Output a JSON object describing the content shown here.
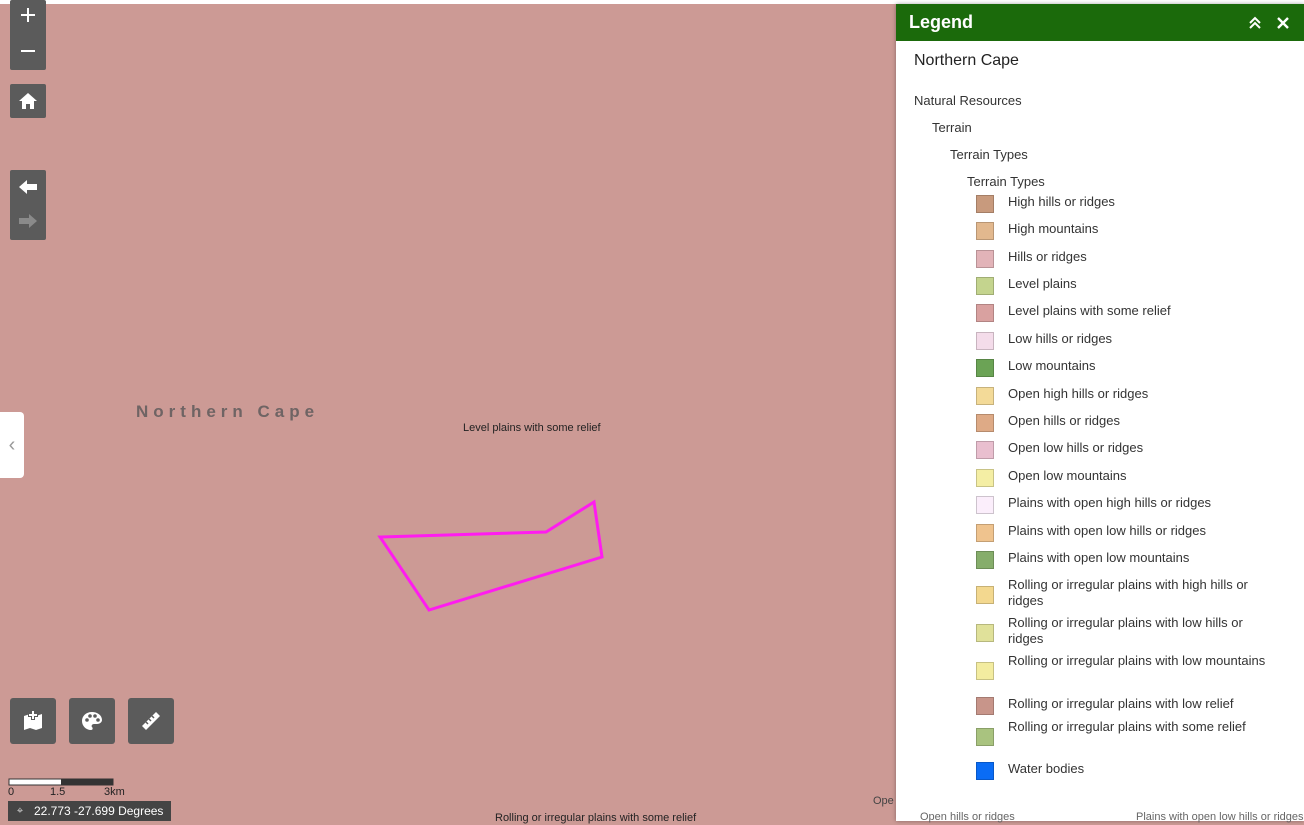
{
  "map": {
    "region_label": "Northern Cape",
    "center_label": "Level plains with some relief",
    "bottom_label": "Rolling or irregular plains with some relief",
    "edge_label": "Ope"
  },
  "scalebar": {
    "ticks": [
      "0",
      "1.5",
      "3km"
    ]
  },
  "coords": {
    "text": "22.773 -27.699 Degrees"
  },
  "legend": {
    "title": "Legend",
    "layer_title": "Northern Cape",
    "tree": [
      "Natural Resources",
      "Terrain",
      "Terrain Types",
      "Terrain Types"
    ],
    "items": [
      {
        "label": "High hills or ridges",
        "color": "#c89a7d"
      },
      {
        "label": "High mountains",
        "color": "#e2b88e"
      },
      {
        "label": "Hills or ridges",
        "color": "#e2b3b8"
      },
      {
        "label": "Level plains",
        "color": "#c4d48e"
      },
      {
        "label": "Level plains with some relief",
        "color": "#d9a1a0"
      },
      {
        "label": "Low hills or ridges",
        "color": "#f4dcea"
      },
      {
        "label": "Low mountains",
        "color": "#6ba355"
      },
      {
        "label": "Open high hills or ridges",
        "color": "#f3da98"
      },
      {
        "label": "Open hills or ridges",
        "color": "#deaa86"
      },
      {
        "label": "Open low hills or ridges",
        "color": "#e9bfcf"
      },
      {
        "label": "Open low mountains",
        "color": "#f4eea4"
      },
      {
        "label": "Plains with open high hills or ridges",
        "color": "#fbeefb"
      },
      {
        "label": "Plains with open low hills or ridges",
        "color": "#efc38e"
      },
      {
        "label": "Plains with open low mountains",
        "color": "#86ad6b"
      },
      {
        "label": "Rolling or irregular plains with high hills or ridges",
        "color": "#f3d88f"
      },
      {
        "label": "Rolling or irregular plains with low hills or ridges",
        "color": "#e0e19a"
      },
      {
        "label": "Rolling or irregular plains with low mountains",
        "color": "#f3eca0"
      },
      {
        "label": "Rolling or irregular plains with low relief",
        "color": "#c8958a"
      },
      {
        "label": "Rolling or irregular plains with some relief",
        "color": "#a9c37f"
      },
      {
        "label": "Water bodies",
        "color": "#0a6cf5"
      }
    ],
    "bottom_left": "Open hills or ridges",
    "bottom_right": "Plains with open low hills or ridges"
  }
}
